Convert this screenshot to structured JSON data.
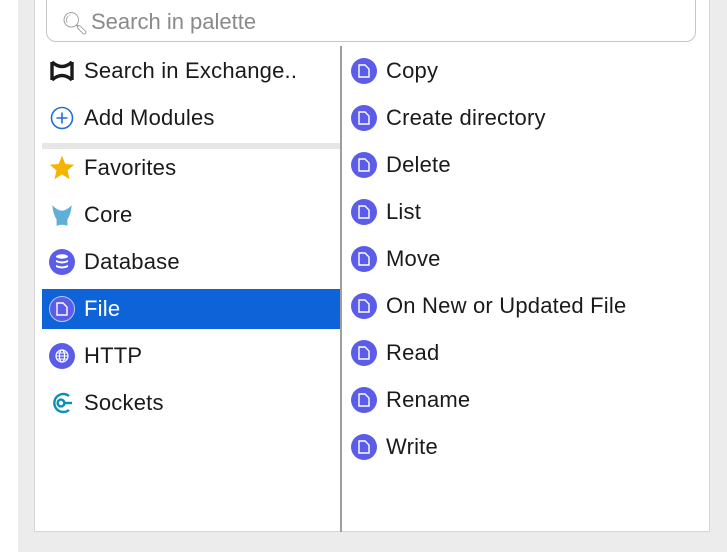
{
  "search": {
    "placeholder": "Search in palette"
  },
  "left_items": [
    {
      "label": "Search in Exchange..",
      "icon": "exchange-icon",
      "selected": false
    },
    {
      "label": "Add Modules",
      "icon": "plus-circle-icon",
      "selected": false
    },
    {
      "label": "Favorites",
      "icon": "star-icon",
      "selected": false
    },
    {
      "label": "Core",
      "icon": "core-icon",
      "selected": false
    },
    {
      "label": "Database",
      "icon": "database-icon",
      "selected": false
    },
    {
      "label": "File",
      "icon": "file-icon",
      "selected": true
    },
    {
      "label": "HTTP",
      "icon": "globe-icon",
      "selected": false
    },
    {
      "label": "Sockets",
      "icon": "sockets-icon",
      "selected": false
    }
  ],
  "operations": [
    {
      "label": "Copy",
      "icon": "file-icon"
    },
    {
      "label": "Create directory",
      "icon": "file-icon"
    },
    {
      "label": "Delete",
      "icon": "file-icon"
    },
    {
      "label": "List",
      "icon": "file-icon"
    },
    {
      "label": "Move",
      "icon": "file-icon"
    },
    {
      "label": "On New or Updated File",
      "icon": "file-icon"
    },
    {
      "label": "Read",
      "icon": "file-icon"
    },
    {
      "label": "Rename",
      "icon": "file-icon"
    },
    {
      "label": "Write",
      "icon": "file-icon"
    }
  ],
  "colors": {
    "selection": "#0f63d8",
    "module_icon": "#5b5ce8",
    "star": "#f5b400",
    "core": "#5fb0d8",
    "sockets": "#0a8fb4",
    "add_modules": "#1f6fd6"
  }
}
